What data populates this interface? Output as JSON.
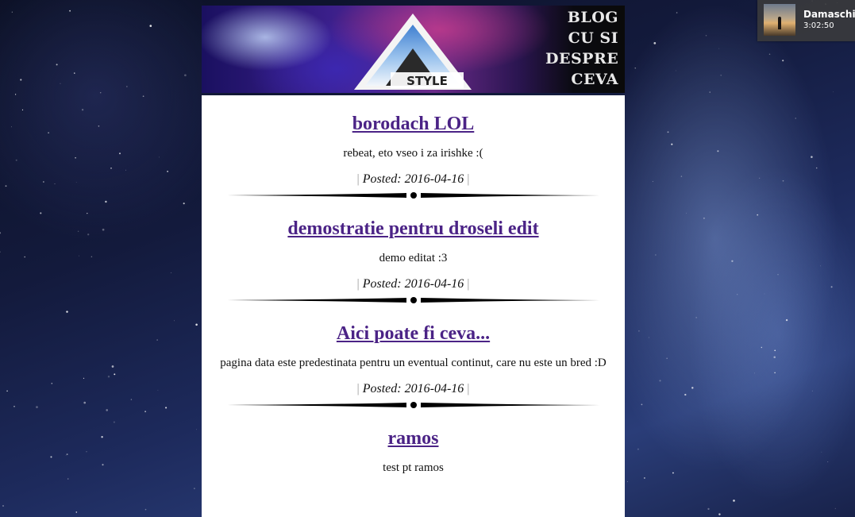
{
  "banner": {
    "logo_text": "STYLE",
    "tagline_lines": [
      "BLOG",
      "CU SI",
      "DESPRE",
      "CEVA"
    ]
  },
  "posts": [
    {
      "title": "borodach LOL",
      "body": "rebeat, eto vseo i za irishke :(",
      "meta_label": "Posted: 2016-04-16"
    },
    {
      "title": "demostratie pentru droseli edit",
      "body": "demo editat :3",
      "meta_label": "Posted: 2016-04-16"
    },
    {
      "title": "Aici poate fi ceva...",
      "body": "pagina data este predestinata pentru un eventual continut, care nu este un bred :D",
      "meta_label": "Posted: 2016-04-16"
    },
    {
      "title": "ramos",
      "body": "test pt ramos",
      "meta_label": ""
    }
  ],
  "meta_separator": "|",
  "notification": {
    "name": "Damaschin",
    "time": "3:02:50"
  },
  "colors": {
    "link": "#4b2386",
    "content_bg": "#ffffff"
  }
}
